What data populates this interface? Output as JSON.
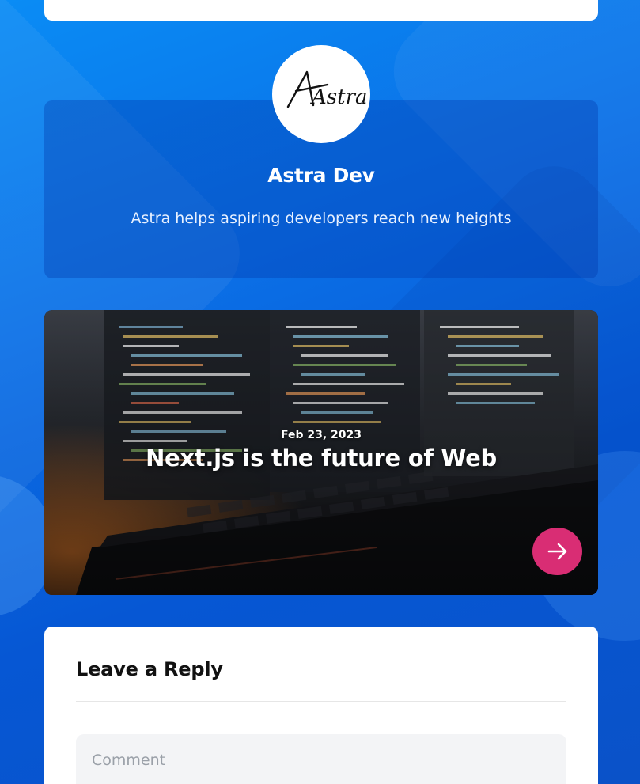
{
  "author": {
    "logo_text": "Astra",
    "name": "Astra Dev",
    "bio": "Astra helps aspiring developers reach new heights"
  },
  "post": {
    "date": "Feb 23, 2023",
    "title": "Next.js is the future of Web",
    "arrow_icon": "arrow-right-icon"
  },
  "reply": {
    "title": "Leave a Reply",
    "comment_placeholder": "Comment",
    "comment_value": ""
  },
  "colors": {
    "background_gradient_start": "#0a8cf5",
    "background_gradient_end": "#0a52c8",
    "accent_button": "#d92d74",
    "card_white": "#ffffff",
    "input_bg": "#f3f4f6"
  }
}
